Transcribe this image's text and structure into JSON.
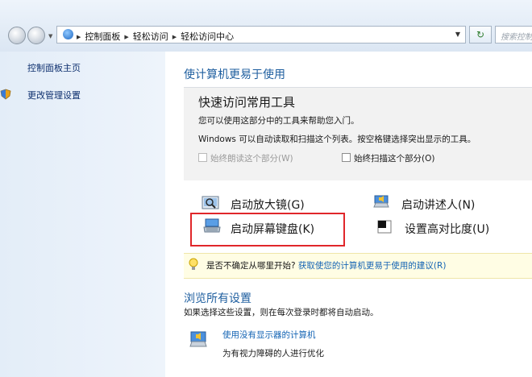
{
  "address_bar": {
    "breadcrumbs": [
      "控制面板",
      "轻松访问",
      "轻松访问中心"
    ],
    "search_placeholder": "搜索控制"
  },
  "sidebar": {
    "items": [
      {
        "label": "控制面板主页"
      },
      {
        "label": "更改管理设置",
        "icon": "shield-icon"
      }
    ]
  },
  "main": {
    "title": "使计算机更易于使用",
    "quick_access": {
      "title": "快速访问常用工具",
      "desc1": "您可以使用这部分中的工具来帮助您入门。",
      "desc2": "Windows 可以自动读取和扫描这个列表。按空格键选择突出显示的工具。",
      "checkboxes": [
        {
          "label": "始终朗读这个部分(W)",
          "checked": false,
          "enabled": false
        },
        {
          "label": "始终扫描这个部分(O)",
          "checked": false,
          "enabled": true
        }
      ],
      "tools": [
        {
          "label": "启动放大镜(G)",
          "icon": "magnifier-icon"
        },
        {
          "label": "启动讲述人(N)",
          "icon": "narrator-icon"
        },
        {
          "label": "启动屏幕键盘(K)",
          "icon": "on-screen-keyboard-icon",
          "highlighted": true
        },
        {
          "label": "设置高对比度(U)",
          "icon": "high-contrast-icon"
        }
      ]
    },
    "tip": {
      "text": "是否不确定从哪里开始?",
      "link": "获取使您的计算机更易于使用的建议(R)",
      "icon": "lightbulb-icon"
    },
    "browse": {
      "title": "浏览所有设置",
      "desc": "如果选择这些设置，则在每次登录时都将自动启动。",
      "items": [
        {
          "link": "使用没有显示器的计算机",
          "desc": "为有视力障碍的人进行优化",
          "icon": "monitor-speaker-icon"
        }
      ]
    }
  },
  "colors": {
    "accent_title": "#1e5e9f",
    "link": "#1464b4",
    "highlight_box": "#e0262a",
    "tip_background": "#fffde4"
  }
}
